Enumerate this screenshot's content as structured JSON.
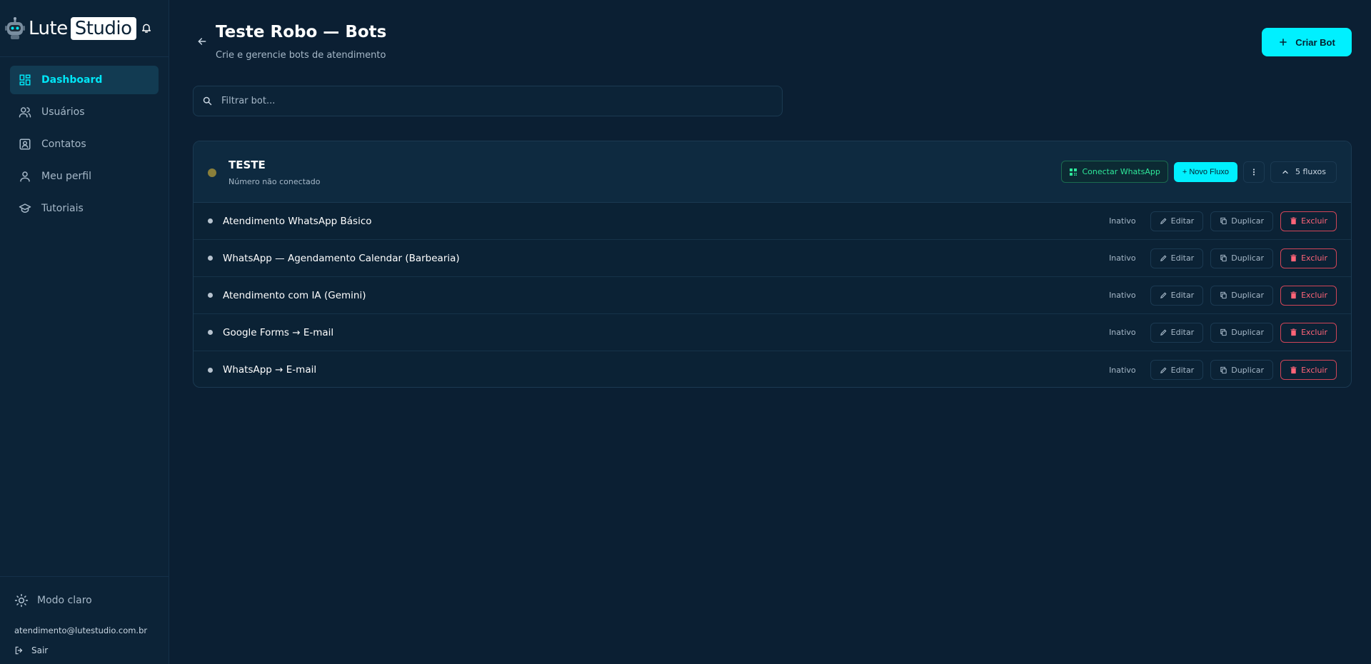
{
  "brand": {
    "logo_left": "Lute",
    "logo_right": "Studio"
  },
  "nav": [
    {
      "label": "Dashboard",
      "icon": "dashboard-icon",
      "active": true
    },
    {
      "label": "Usuários",
      "icon": "users-icon"
    },
    {
      "label": "Contatos",
      "icon": "contacts-icon"
    },
    {
      "label": "Meu perfil",
      "icon": "user-icon"
    },
    {
      "label": "Tutoriais",
      "icon": "graduation-cap-icon"
    }
  ],
  "sidebar_footer": {
    "theme_label": "Modo claro",
    "email": "atendimento@lutestudio.com.br",
    "logout_label": "Sair"
  },
  "header": {
    "title": "Teste Robo — Bots",
    "subtitle": "Crie e gerencie bots de atendimento",
    "create_label": "Criar Bot"
  },
  "search": {
    "placeholder": "Filtrar bot..."
  },
  "bot": {
    "name": "TESTE",
    "status_text": "Número não conectado",
    "connect_label": "Conectar WhatsApp",
    "new_flow_label": "+ Novo Fluxo",
    "flows_count_label": "5 fluxos",
    "flows": [
      {
        "name": "Atendimento WhatsApp Básico",
        "status": "Inativo"
      },
      {
        "name": "WhatsApp — Agendamento Calendar (Barbearia)",
        "status": "Inativo"
      },
      {
        "name": "Atendimento com IA (Gemini)",
        "status": "Inativo"
      },
      {
        "name": "Google Forms → E-mail",
        "status": "Inativo"
      },
      {
        "name": "WhatsApp → E-mail",
        "status": "Inativo"
      }
    ],
    "actions": {
      "edit": "Editar",
      "duplicate": "Duplicar",
      "delete": "Excluir"
    }
  },
  "colors": {
    "accent": "#00f0ff",
    "background": "#0b1f33",
    "danger": "#ff6478",
    "success": "#2ee89a"
  }
}
